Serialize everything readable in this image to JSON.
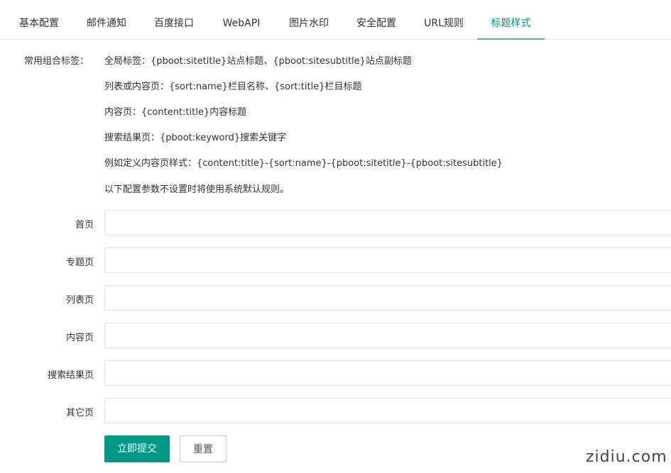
{
  "tabs": [
    {
      "label": "基本配置",
      "active": false
    },
    {
      "label": "邮件通知",
      "active": false
    },
    {
      "label": "百度接口",
      "active": false
    },
    {
      "label": "WebAPI",
      "active": false
    },
    {
      "label": "图片水印",
      "active": false
    },
    {
      "label": "安全配置",
      "active": false
    },
    {
      "label": "URL规则",
      "active": false
    },
    {
      "label": "标题样式",
      "active": true
    }
  ],
  "help": {
    "label": "常用组合标签：",
    "lines": [
      "全局标签：{pboot:sitetitle}站点标题、{pboot:sitesubtitle}站点副标题",
      "列表或内容页：{sort:name}栏目名称、{sort:title}栏目标题",
      "内容页：{content:title}内容标题",
      "搜索结果页：{pboot:keyword}搜索关键字",
      "例如定义内容页样式：{content:title}-{sort:name}-{pboot:sitetitle}-{pboot:sitesubtitle}",
      "以下配置参数不设置时将使用系统默认规则。"
    ]
  },
  "fields": [
    {
      "label": "首页",
      "value": "",
      "placeholder": ""
    },
    {
      "label": "专题页",
      "value": "",
      "placeholder": ""
    },
    {
      "label": "列表页",
      "value": "",
      "placeholder": ""
    },
    {
      "label": "内容页",
      "value": "",
      "placeholder": ""
    },
    {
      "label": "搜索结果页",
      "value": "",
      "placeholder": ""
    },
    {
      "label": "其它页",
      "value": "",
      "placeholder": ""
    }
  ],
  "buttons": {
    "submit": "立即提交",
    "reset": "重置"
  },
  "watermark": "zidiu.com",
  "colors": {
    "accent": "#009688",
    "active_underline": "#5fb878",
    "border": "#e6e6e6"
  }
}
